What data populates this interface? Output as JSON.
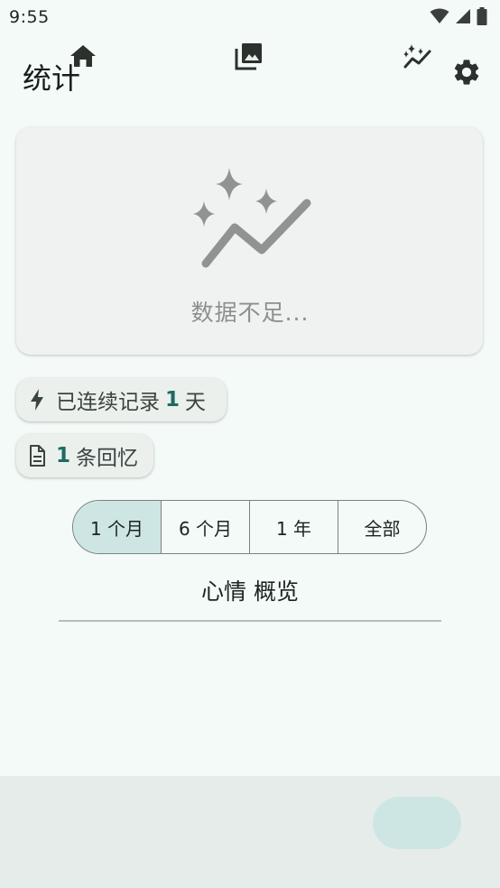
{
  "status_bar": {
    "time": "9:55"
  },
  "header": {
    "title": "统计",
    "settings_icon": "gear-icon"
  },
  "empty_state": {
    "icon": "sparkle-trend-icon",
    "message": "数据不足..."
  },
  "chips": {
    "streak": {
      "icon": "bolt-icon",
      "prefix": "已连续记录",
      "count": "1",
      "suffix": "天"
    },
    "memories": {
      "icon": "document-icon",
      "count": "1",
      "suffix": "条回忆"
    }
  },
  "range_selector": {
    "options": [
      "1 个月",
      "6 个月",
      "1 年",
      "全部"
    ],
    "selected": "1 个月"
  },
  "mood_overview": {
    "title": "心情 概览"
  },
  "bottom_nav": {
    "items": [
      {
        "icon": "home-icon"
      },
      {
        "icon": "gallery-icon"
      },
      {
        "icon": "insights-icon",
        "active": true
      }
    ]
  },
  "colors": {
    "accent": "#1e6b62",
    "selected_bg": "#cde6e3",
    "background": "#f3faf7"
  }
}
